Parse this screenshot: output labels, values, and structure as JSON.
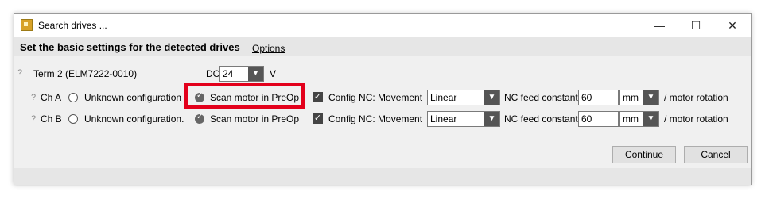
{
  "window": {
    "title": "Search drives ...",
    "minimize": "—",
    "maximize": "☐",
    "close": "✕"
  },
  "header": {
    "title": "Set the basic settings for the detected drives",
    "options_link": "Options"
  },
  "terminal": {
    "help": "?",
    "name": "Term 2 (ELM7222-0010)",
    "dc_label": "DC",
    "dc_value": "24",
    "dc_unit": "V"
  },
  "channels": [
    {
      "help": "?",
      "name": "Ch A",
      "unknown_label": "Unknown configuration",
      "scan_label": "Scan motor in PreOp",
      "scan_selected": true,
      "config_nc_checked": true,
      "config_nc_label": "Config NC: Movement",
      "movement": "Linear",
      "feed_label": "NC feed constant",
      "feed_value": "60",
      "unit": "mm",
      "per_label": "/ motor rotation"
    },
    {
      "help": "?",
      "name": "Ch B",
      "unknown_label": "Unknown configuration.",
      "scan_label": "Scan motor in PreOp",
      "scan_selected": true,
      "config_nc_checked": true,
      "config_nc_label": "Config NC: Movement",
      "movement": "Linear",
      "feed_label": "NC feed constant",
      "feed_value": "60",
      "unit": "mm",
      "per_label": "/ motor rotation"
    }
  ],
  "buttons": {
    "continue": "Continue",
    "cancel": "Cancel"
  },
  "icons": {
    "check": "✓",
    "dropdown": "▼"
  },
  "colors": {
    "highlight": "#e3001b"
  }
}
